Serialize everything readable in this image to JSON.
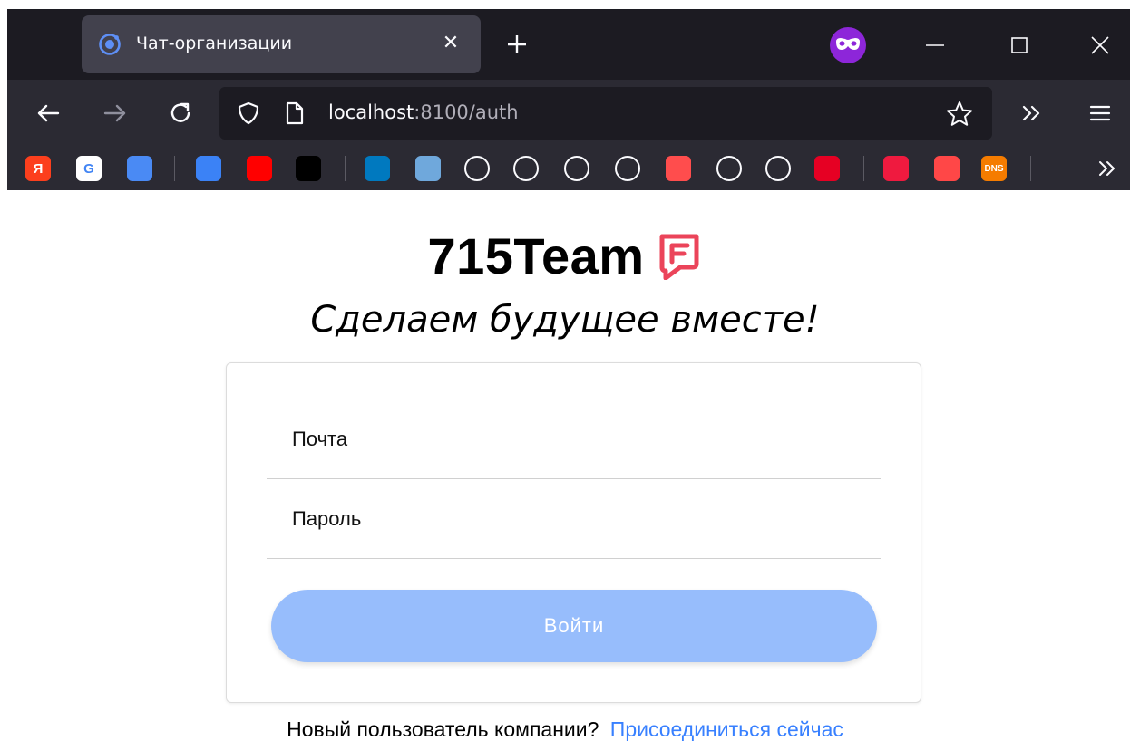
{
  "browser": {
    "tab": {
      "title": "Чат-организации",
      "close_glyph": "✕",
      "icon": "ionic-logo-icon"
    },
    "address": {
      "host": "localhost",
      "rest": ":8100/auth"
    },
    "bookmarks": [
      {
        "icon": "yandex-icon",
        "label": "Я",
        "color": "#fc3f1d"
      },
      {
        "icon": "google-icon",
        "label": "G",
        "color": "#ffffff"
      },
      {
        "icon": "google-translate-icon",
        "label": "",
        "color": "#4a8af4"
      },
      {
        "icon": "chat-icon",
        "label": "",
        "color": "#3b82f6"
      },
      {
        "icon": "youtube-icon",
        "label": "",
        "color": "#ff0000"
      },
      {
        "icon": "tiktok-icon",
        "label": "",
        "color": "#000000"
      },
      {
        "icon": "trello-icon",
        "label": "",
        "color": "#0079bf"
      },
      {
        "icon": "image-app-icon",
        "label": "",
        "color": "#6fa8dc"
      },
      {
        "icon": "github-icon",
        "label": "",
        "color": "#2b2a33"
      },
      {
        "icon": "diamond-icon",
        "label": "",
        "color": "#2b2a33"
      },
      {
        "icon": "github-icon",
        "label": "",
        "color": "#2b2a33"
      },
      {
        "icon": "android-icon",
        "label": "",
        "color": "#2b2a33"
      },
      {
        "icon": "record-icon",
        "label": "",
        "color": "#ff4d4d"
      },
      {
        "icon": "globe-icon",
        "label": "",
        "color": "#2b2a33"
      },
      {
        "icon": "globe-icon",
        "label": "",
        "color": "#2b2a33"
      },
      {
        "icon": "pinterest-icon",
        "label": "",
        "color": "#e60023"
      },
      {
        "icon": "oval-logo-icon",
        "label": "",
        "color": "#ef1a3f"
      },
      {
        "icon": "aliexpress-icon",
        "label": "",
        "color": "#ff4747"
      },
      {
        "icon": "dns-icon",
        "label": "DNS",
        "color": "#f57c00"
      }
    ]
  },
  "page": {
    "brand": {
      "name": "715Team",
      "logo": "brand-flag-icon",
      "logo_color": "#eb445a"
    },
    "slogan": "Сделаем будущее вместе!",
    "form": {
      "email_placeholder": "Почта",
      "email_value": "",
      "password_placeholder": "Пароль",
      "password_value": "",
      "submit_label": "Войти",
      "submit_color": "#97bdfc"
    },
    "signup": {
      "text": "Новый пользователь компании?",
      "link": "Присоединиться сейчас",
      "link_color": "#3880ff"
    }
  }
}
